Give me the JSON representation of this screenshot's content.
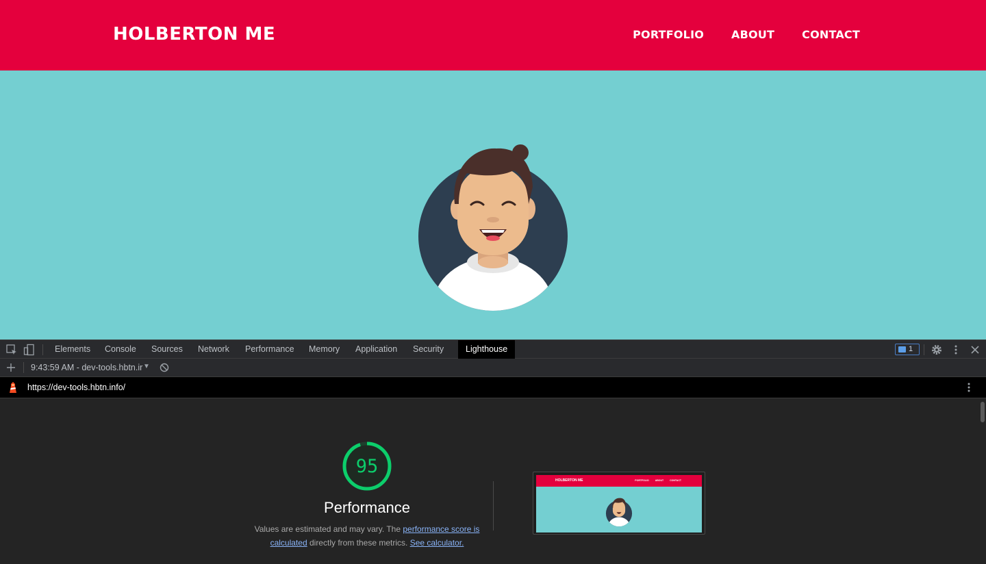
{
  "site": {
    "logo": "HOLBERTON ME",
    "nav": [
      "PORTFOLIO",
      "ABOUT",
      "CONTACT"
    ],
    "colors": {
      "header": "#e4003d",
      "hero": "#74cfd1"
    }
  },
  "devtools": {
    "tabs": [
      "Elements",
      "Console",
      "Sources",
      "Network",
      "Performance",
      "Memory",
      "Application",
      "Security",
      "Lighthouse"
    ],
    "active_tab": "Lighthouse",
    "issues_count": "1",
    "report_select": "9:43:59 AM - dev-tools.hbtn.ir",
    "url": "https://dev-tools.hbtn.info/",
    "icons": [
      "inspect-element-icon",
      "device-toolbar-icon",
      "settings-gear-icon",
      "more-vertical-icon",
      "close-icon",
      "add-icon",
      "clear-icon",
      "lighthouse-logo-icon"
    ]
  },
  "report": {
    "score": "95",
    "score_color": "#0cce6b",
    "title": "Performance",
    "desc_before": "Values are estimated and may vary. The ",
    "link1": "performance score is calculated",
    "desc_middle": " directly from these metrics. ",
    "link2": "See calculator.",
    "thumbnail": {
      "logo": "HOLBERTON ME",
      "nav": [
        "PORTFOLIO",
        "ABOUT",
        "CONTACT"
      ]
    }
  }
}
